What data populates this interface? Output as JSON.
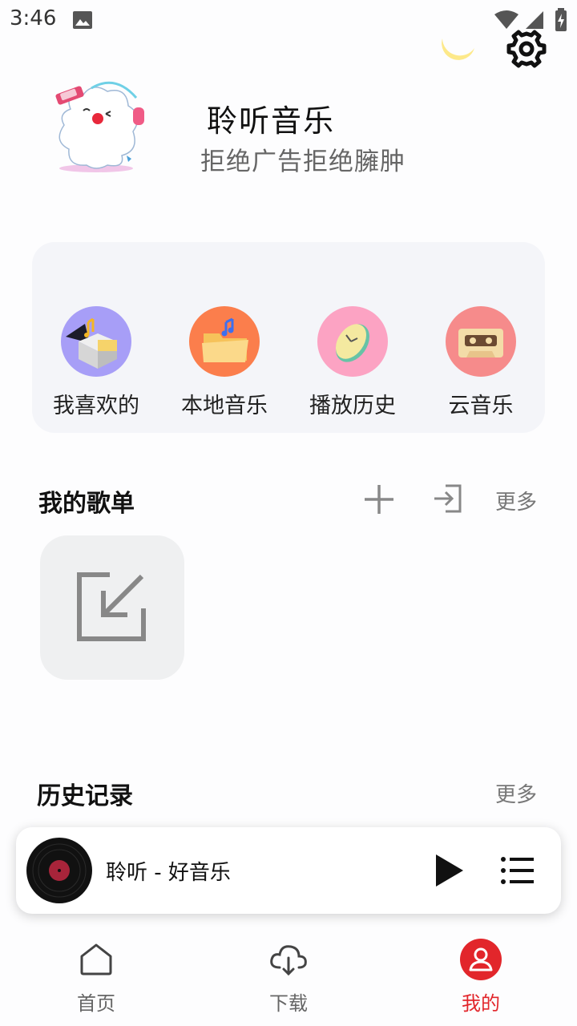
{
  "status_bar": {
    "time": "3:46"
  },
  "header": {
    "app_name": "聆听音乐",
    "tagline": "拒绝广告拒绝臃肿",
    "icons": [
      "moon-icon",
      "settings-icon"
    ]
  },
  "quick_access": [
    {
      "label": "我喜欢的",
      "icon": "favorites-box-icon",
      "color": "#a79ef7"
    },
    {
      "label": "本地音乐",
      "icon": "local-folder-icon",
      "color": "#fb7e4c"
    },
    {
      "label": "播放历史",
      "icon": "clock-history-icon",
      "color": "#fca3c3"
    },
    {
      "label": "云音乐",
      "icon": "cassette-icon",
      "color": "#f68b8b"
    }
  ],
  "playlists": {
    "title": "我的歌单",
    "more": "更多"
  },
  "history": {
    "title": "历史记录",
    "more": "更多"
  },
  "player": {
    "track": "聆听 - 好音乐"
  },
  "nav": [
    {
      "label": "首页",
      "icon": "home-icon",
      "active": false
    },
    {
      "label": "下载",
      "icon": "cloud-download-icon",
      "active": false
    },
    {
      "label": "我的",
      "icon": "profile-icon",
      "active": true
    }
  ],
  "colors": {
    "accent": "#e2262b",
    "card_bg": "#f4f5f9",
    "tile_bg": "#eff0f1"
  }
}
